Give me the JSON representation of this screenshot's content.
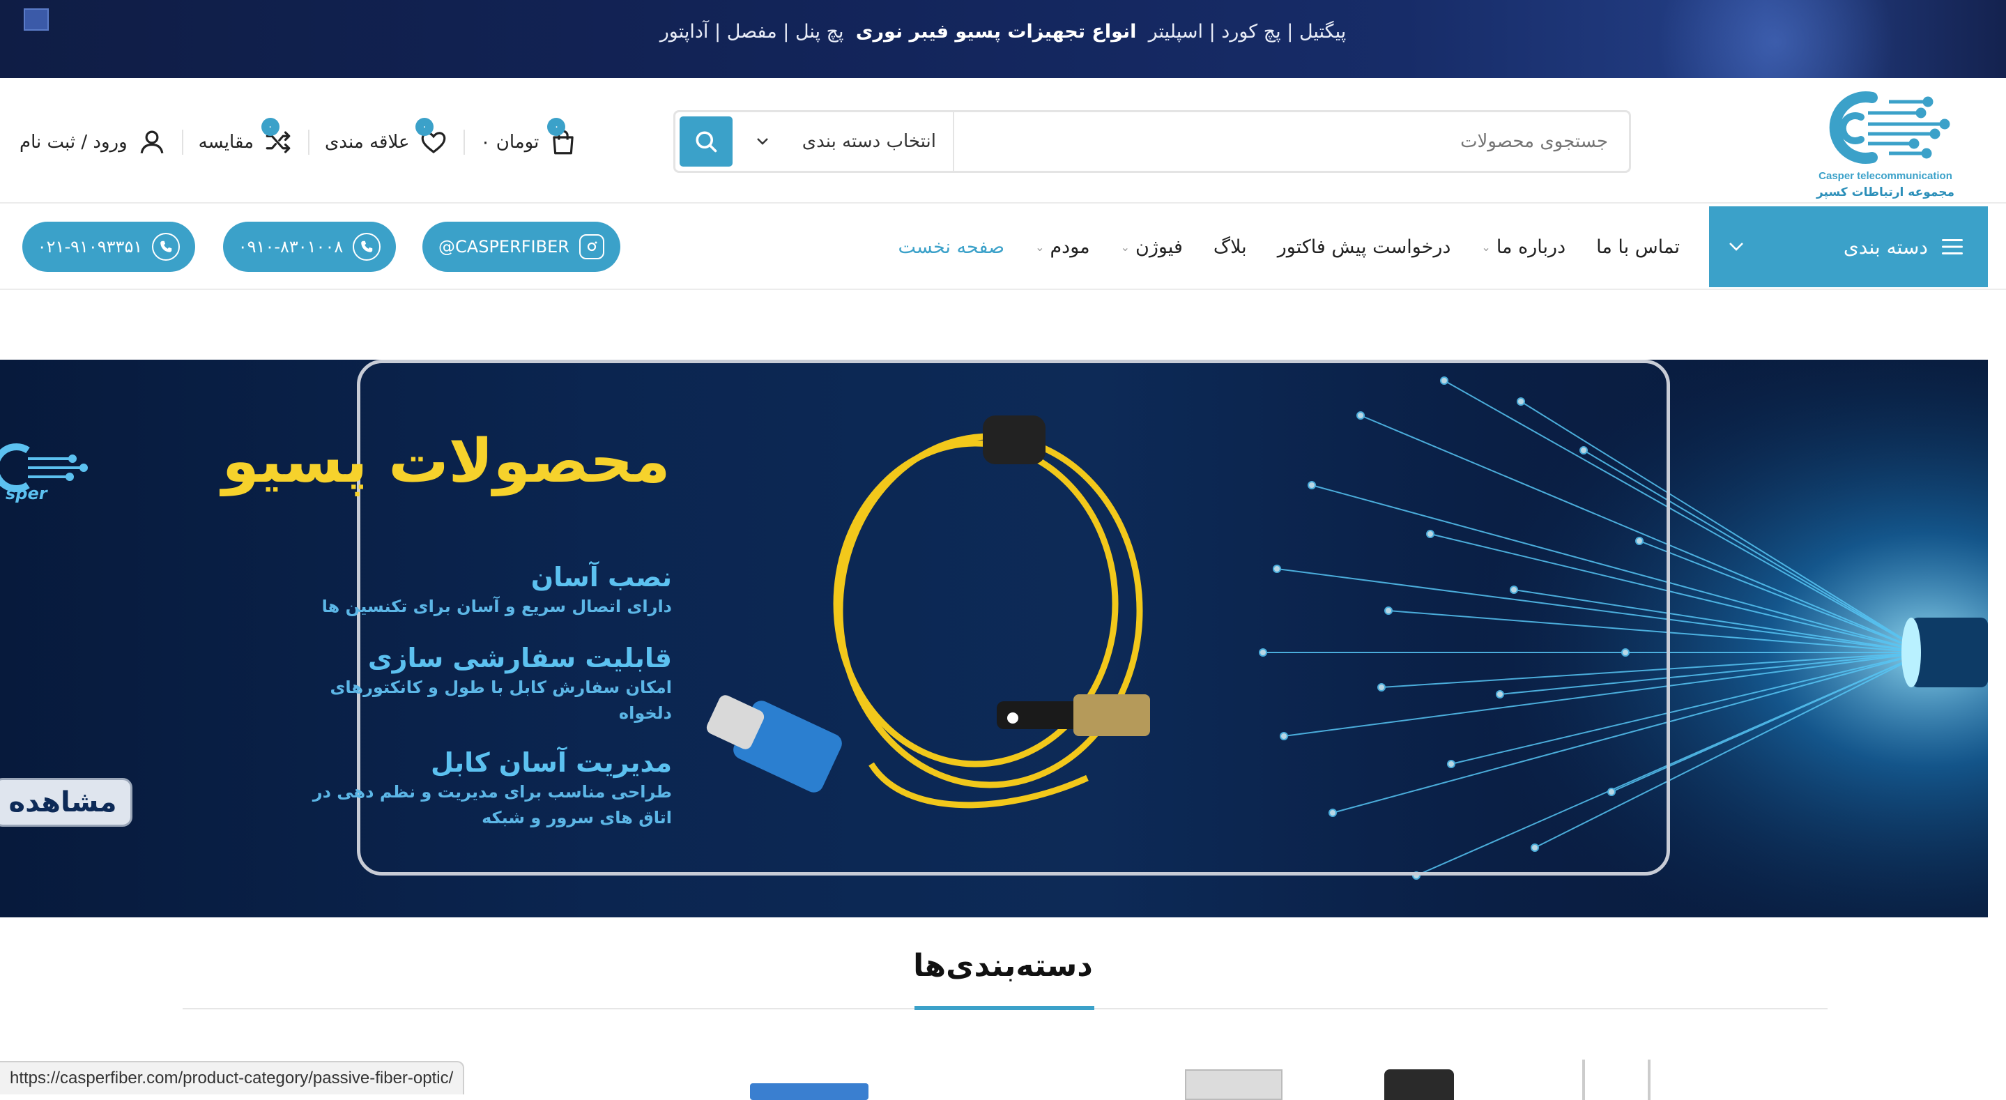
{
  "topbar": {
    "links": [
      "پیگتیل",
      "پچ کورد",
      "اسپلیتر"
    ],
    "highlight": "انواع تجهیزات پسیو فیبر نوری",
    "links2": [
      "پچ پنل",
      "مفصل",
      "آداپتور"
    ],
    "separator": " | "
  },
  "logo": {
    "en": "Casper telecommunication",
    "fa": "مجموعه ارتباطات کسپر"
  },
  "search": {
    "placeholder": "جستجوی محصولات",
    "category_label": "انتخاب دسته بندی",
    "icon": "search-icon"
  },
  "header_actions": {
    "cart_label": "۰ تومان",
    "cart_count": "۰",
    "wishlist_label": "علاقه مندی",
    "wishlist_count": "۰",
    "compare_label": "مقایسه",
    "compare_count": "۰",
    "account_label": "ورود / ثبت نام"
  },
  "nav": {
    "categories_label": "دسته بندی",
    "items": [
      {
        "label": "صفحه نخست",
        "active": true,
        "dropdown": false
      },
      {
        "label": "مودم",
        "active": false,
        "dropdown": true
      },
      {
        "label": "فیوژن",
        "active": false,
        "dropdown": true
      },
      {
        "label": "بلاگ",
        "active": false,
        "dropdown": false
      },
      {
        "label": "درخواست پیش فاکتور",
        "active": false,
        "dropdown": false
      },
      {
        "label": "درباره ما",
        "active": false,
        "dropdown": true
      },
      {
        "label": "تماس با ما",
        "active": false,
        "dropdown": false
      }
    ],
    "contacts": {
      "instagram": "@CASPERFIBER",
      "mobile": "۰۹۱۰-۸۳۰۱۰۰۸",
      "phone": "۰۲۱-۹۱۰۹۳۳۵۱"
    }
  },
  "hero": {
    "title": "محصولات پسیو",
    "features": [
      {
        "title": "نصب آسان",
        "desc": "دارای اتصال سریع و آسان برای تکنسین ها"
      },
      {
        "title": "قابلیت سفارشی سازی",
        "desc": "امکان سفارش کابل با طول و کانکتورهای دلخواه"
      },
      {
        "title": "مدیریت آسان کابل",
        "desc": "طراحی مناسب برای مدیریت و نظم دهی در اتاق های سرور و شبکه"
      }
    ],
    "cta": "مشاهده",
    "logo_text": "sper"
  },
  "categories": {
    "title": "دسته‌بندی‌ها"
  },
  "statusbar": {
    "url": "https://casperfiber.com/product-category/passive-fiber-optic/"
  },
  "colors": {
    "accent": "#3ba1c9",
    "topbar_bg": "#13255b",
    "hero_bg": "#0b2550",
    "hero_title": "#f6d22c",
    "hero_feature": "#5cc1f0"
  }
}
